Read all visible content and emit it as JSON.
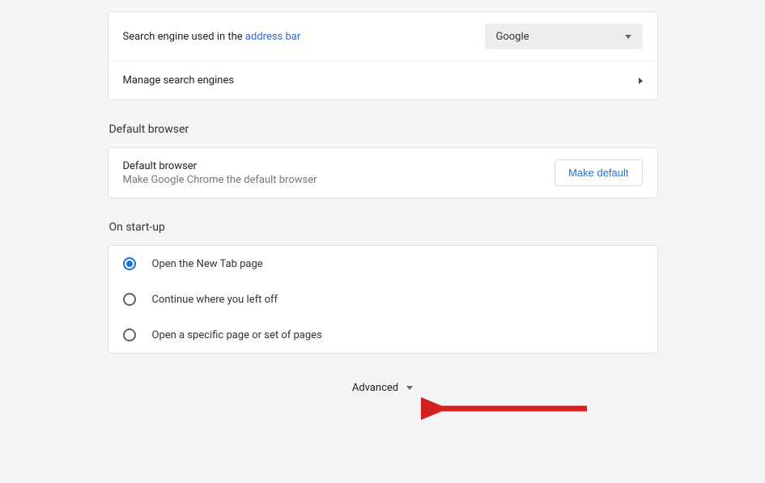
{
  "search_engine": {
    "label_prefix": "Search engine used in the ",
    "label_link": "address bar",
    "selected": "Google",
    "manage_label": "Manage search engines"
  },
  "default_browser": {
    "section_title": "Default browser",
    "label": "Default browser",
    "desc": "Make Google Chrome the default browser",
    "button": "Make default"
  },
  "startup": {
    "section_title": "On start-up",
    "options": [
      {
        "label": "Open the New Tab page",
        "selected": true
      },
      {
        "label": "Continue where you left off",
        "selected": false
      },
      {
        "label": "Open a specific page or set of pages",
        "selected": false
      }
    ]
  },
  "advanced_label": "Advanced"
}
